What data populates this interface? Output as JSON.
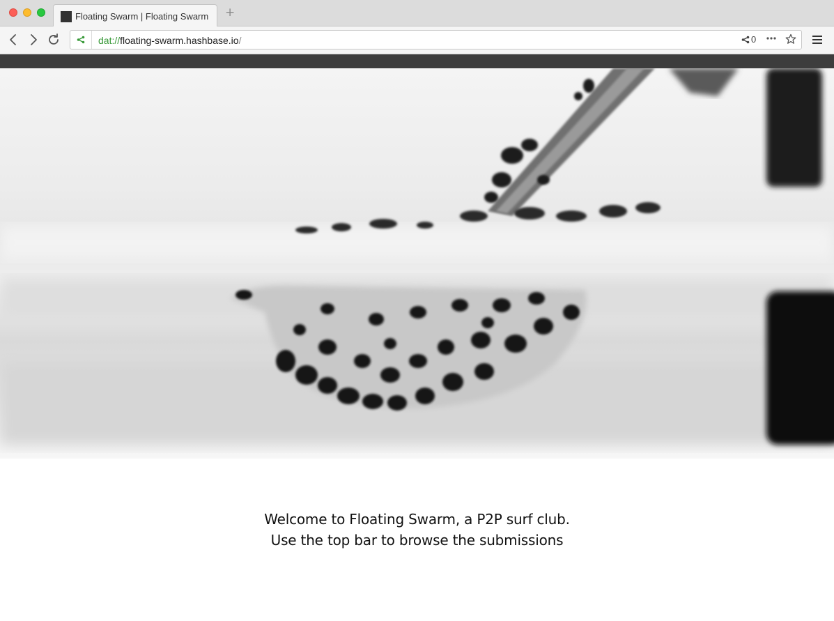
{
  "browser": {
    "tab_title": "Floating Swarm | Floating Swarm",
    "new_tab_label": "+",
    "url_protocol": "dat://",
    "url_host": "floating-swarm.hashbase.io",
    "url_tail": "/",
    "peer_count": "0"
  },
  "page": {
    "welcome_line1": "Welcome to Floating Swarm, a P2P surf club.",
    "welcome_line2": "Use the top bar to browse the submissions"
  }
}
